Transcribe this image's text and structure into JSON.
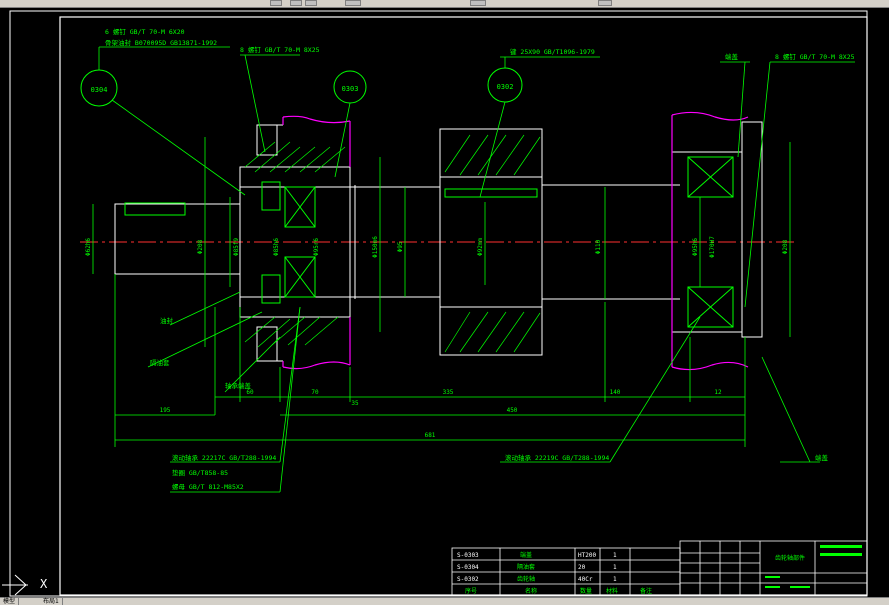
{
  "toolbar": {
    "buttons": [
      "btn1",
      "btn2",
      "btn3",
      "btn4",
      "btn5"
    ]
  },
  "drawing": {
    "balloons": [
      "0304",
      "0303",
      "0302"
    ],
    "top_labels": {
      "screw_a_1": "6 螺钉 GB/T 70-M 6X20",
      "screw_a_2": "骨架油封 B070095D GB13871-1992",
      "screw_b": "8 螺钉 GB/T 70-M 8X25",
      "key": "键 25X90 GB/T1096-1979",
      "end_cap": "端盖",
      "screw_c": "8 螺钉 GB/T 70-M 8X25"
    },
    "left_labels": {
      "oil_seal": "油封",
      "seal_sleeve": "隔油套",
      "bearing_cap": "轴承端盖"
    },
    "bottom_labels": {
      "bearing_left": "滚动轴承 22217C GB/T288-1994",
      "washer": "垫圈 GB/T858-85",
      "nut": "螺母 GB/T 812-M85X2",
      "bearing_right": "滚动轴承 22219C GB/T288-1994",
      "end_cover": "端盖"
    },
    "dimensions": [
      "195",
      "60",
      "70",
      "35",
      "335",
      "140",
      "12",
      "450",
      "681"
    ],
    "vertical_dims": [
      "Φ62h6",
      "Φ208",
      "Φ85f9",
      "Φ85h6",
      "Φ150m6",
      "Φ95",
      "Φ95r6",
      "Φ92mm",
      "Φ110",
      "Φ95h6",
      "Φ170H7",
      "Φ208"
    ]
  },
  "parts_table": {
    "rows": [
      {
        "code": "S-0303",
        "name": "端盖",
        "material": "HT200",
        "qty": "1"
      },
      {
        "code": "S-0304",
        "name": "隔油套",
        "material": "20",
        "qty": "1"
      },
      {
        "code": "S-0302",
        "name": "齿轮轴",
        "material": "40Cr",
        "qty": "1"
      }
    ],
    "header": {
      "c1": "序号",
      "c2": "名称",
      "c3": "数量",
      "c4": "材料",
      "c5": "备注"
    }
  },
  "title_block": {
    "name": "齿轮轴部件"
  },
  "ucs": {
    "x_label": "X"
  },
  "bottom_tabs": [
    "模型",
    "布局1"
  ],
  "colors": {
    "frame": "#ffffff",
    "line": "#00ff00",
    "centerline": "#ff3030",
    "break": "#ff00ff"
  }
}
